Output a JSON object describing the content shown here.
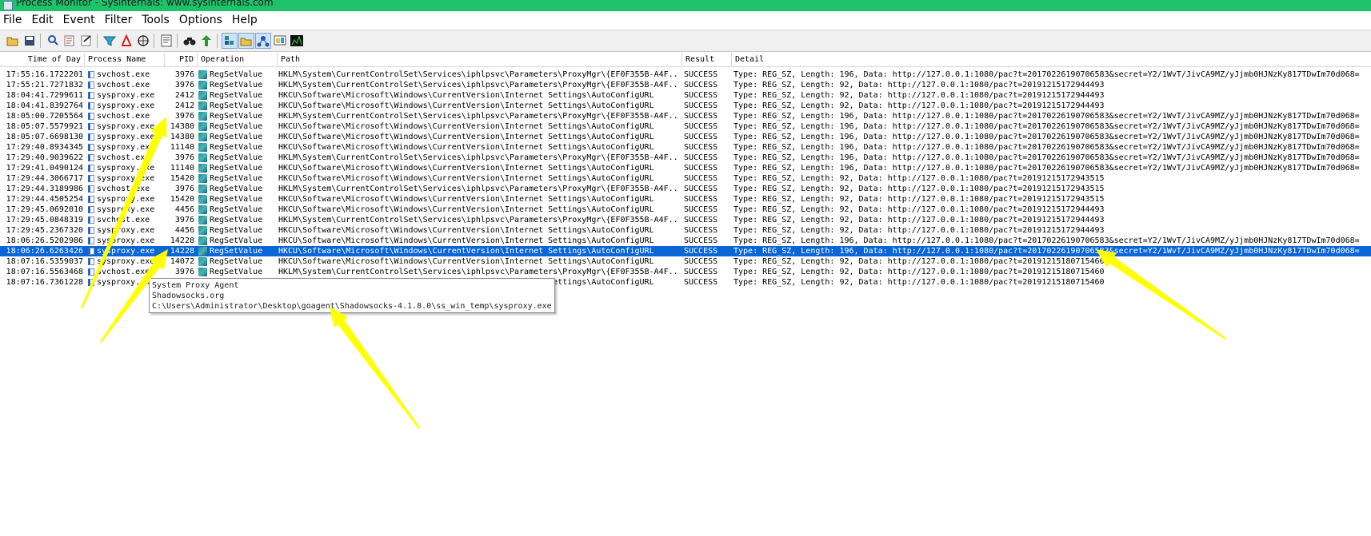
{
  "window": {
    "title": "Process Monitor - Sysinternals: www.sysinternals.com"
  },
  "menu": [
    "File",
    "Edit",
    "Event",
    "Filter",
    "Tools",
    "Options",
    "Help"
  ],
  "toolbar": {
    "buttons": [
      {
        "icon": "open-folder-icon",
        "active": false
      },
      {
        "icon": "save-icon",
        "active": false
      },
      {
        "icon": "magnifier-icon",
        "active": false
      },
      {
        "icon": "autoscroll-icon",
        "active": false
      },
      {
        "icon": "clear-icon",
        "active": false
      },
      {
        "icon": "filter-icon",
        "active": false
      },
      {
        "icon": "highlight-icon",
        "active": false
      },
      {
        "icon": "target-icon",
        "active": false
      },
      {
        "icon": "process-tree-icon",
        "active": false
      },
      {
        "icon": "find-icon",
        "active": false
      },
      {
        "icon": "jump-icon",
        "active": false
      },
      {
        "icon": "registry-activity-icon",
        "active": true
      },
      {
        "icon": "filesystem-activity-icon",
        "active": true
      },
      {
        "icon": "network-activity-icon",
        "active": true
      },
      {
        "icon": "process-activity-icon",
        "active": false
      },
      {
        "icon": "profiling-activity-icon",
        "active": false
      }
    ],
    "colors": {
      "active_bg": "#cfe3f7"
    }
  },
  "columns": [
    "Time of Day",
    "Process Name",
    "PID",
    "Operation",
    "Path",
    "Result",
    "Detail"
  ],
  "selection_color": "#0a66d6",
  "rows": [
    {
      "time": "17:55:16.1722201",
      "process": "svchost.exe",
      "pid": "3976",
      "operation": "RegSetValue",
      "path": "HKLM\\System\\CurrentControlSet\\Services\\iphlpsvc\\Parameters\\ProxyMgr\\{EF0F355B-A4F...",
      "result": "SUCCESS",
      "detail": "Type: REG_SZ, Length: 196, Data: http://127.0.0.1:1080/pac?t=20170226190706583&secret=Y2/1WvT/JivCA9MZ/yJjmb0HJNzKy817TDwIm70d068="
    },
    {
      "time": "17:55:21.7271832",
      "process": "svchost.exe",
      "pid": "3976",
      "operation": "RegSetValue",
      "path": "HKLM\\System\\CurrentControlSet\\Services\\iphlpsvc\\Parameters\\ProxyMgr\\{EF0F355B-A4F...",
      "result": "SUCCESS",
      "detail": "Type: REG_SZ, Length: 92, Data: http://127.0.0.1:1080/pac?t=20191215172944493"
    },
    {
      "time": "18:04:41.7299611",
      "process": "sysproxy.exe",
      "pid": "2412",
      "operation": "RegSetValue",
      "path": "HKCU\\Software\\Microsoft\\Windows\\CurrentVersion\\Internet Settings\\AutoConfigURL",
      "result": "SUCCESS",
      "detail": "Type: REG_SZ, Length: 92, Data: http://127.0.0.1:1080/pac?t=20191215172944493"
    },
    {
      "time": "18:04:41.8392764",
      "process": "sysproxy.exe",
      "pid": "2412",
      "operation": "RegSetValue",
      "path": "HKCU\\Software\\Microsoft\\Windows\\CurrentVersion\\Internet Settings\\AutoConfigURL",
      "result": "SUCCESS",
      "detail": "Type: REG_SZ, Length: 92, Data: http://127.0.0.1:1080/pac?t=20191215172944493"
    },
    {
      "time": "18:05:00.7205564",
      "process": "svchost.exe",
      "pid": "3976",
      "operation": "RegSetValue",
      "path": "HKLM\\System\\CurrentControlSet\\Services\\iphlpsvc\\Parameters\\ProxyMgr\\{EF0F355B-A4F...",
      "result": "SUCCESS",
      "detail": "Type: REG_SZ, Length: 196, Data: http://127.0.0.1:1080/pac?t=20170226190706583&secret=Y2/1WvT/JivCA9MZ/yJjmb0HJNzKy817TDwIm70d068="
    },
    {
      "time": "18:05:07.5579921",
      "process": "sysproxy.exe",
      "pid": "14380",
      "operation": "RegSetValue",
      "path": "HKCU\\Software\\Microsoft\\Windows\\CurrentVersion\\Internet Settings\\AutoConfigURL",
      "result": "SUCCESS",
      "detail": "Type: REG_SZ, Length: 196, Data: http://127.0.0.1:1080/pac?t=20170226190706583&secret=Y2/1WvT/JivCA9MZ/yJjmb0HJNzKy817TDwIm70d068="
    },
    {
      "time": "18:05:07.6698130",
      "process": "sysproxy.exe",
      "pid": "14380",
      "operation": "RegSetValue",
      "path": "HKCU\\Software\\Microsoft\\Windows\\CurrentVersion\\Internet Settings\\AutoConfigURL",
      "result": "SUCCESS",
      "detail": "Type: REG_SZ, Length: 196, Data: http://127.0.0.1:1080/pac?t=20170226190706583&secret=Y2/1WvT/JivCA9MZ/yJjmb0HJNzKy817TDwIm70d068="
    },
    {
      "time": "17:29:40.8934345",
      "process": "sysproxy.exe",
      "pid": "11140",
      "operation": "RegSetValue",
      "path": "HKCU\\Software\\Microsoft\\Windows\\CurrentVersion\\Internet Settings\\AutoConfigURL",
      "result": "SUCCESS",
      "detail": "Type: REG_SZ, Length: 196, Data: http://127.0.0.1:1080/pac?t=20170226190706583&secret=Y2/1WvT/JivCA9MZ/yJjmb0HJNzKy817TDwIm70d068="
    },
    {
      "time": "17:29:40.9039622",
      "process": "svchost.exe",
      "pid": "3976",
      "operation": "RegSetValue",
      "path": "HKLM\\System\\CurrentControlSet\\Services\\iphlpsvc\\Parameters\\ProxyMgr\\{EF0F355B-A4F...",
      "result": "SUCCESS",
      "detail": "Type: REG_SZ, Length: 196, Data: http://127.0.0.1:1080/pac?t=20170226190706583&secret=Y2/1WvT/JivCA9MZ/yJjmb0HJNzKy817TDwIm70d068="
    },
    {
      "time": "17:29:41.0490124",
      "process": "sysproxy.exe",
      "pid": "11140",
      "operation": "RegSetValue",
      "path": "HKCU\\Software\\Microsoft\\Windows\\CurrentVersion\\Internet Settings\\AutoConfigURL",
      "result": "SUCCESS",
      "detail": "Type: REG_SZ, Length: 196, Data: http://127.0.0.1:1080/pac?t=20170226190706583&secret=Y2/1WvT/JivCA9MZ/yJjmb0HJNzKy817TDwIm70d068="
    },
    {
      "time": "17:29:44.3066717",
      "process": "sysproxy.exe",
      "pid": "15420",
      "operation": "RegSetValue",
      "path": "HKCU\\Software\\Microsoft\\Windows\\CurrentVersion\\Internet Settings\\AutoConfigURL",
      "result": "SUCCESS",
      "detail": "Type: REG_SZ, Length: 92, Data: http://127.0.0.1:1080/pac?t=20191215172943515"
    },
    {
      "time": "17:29:44.3189986",
      "process": "svchost.exe",
      "pid": "3976",
      "operation": "RegSetValue",
      "path": "HKLM\\System\\CurrentControlSet\\Services\\iphlpsvc\\Parameters\\ProxyMgr\\{EF0F355B-A4F...",
      "result": "SUCCESS",
      "detail": "Type: REG_SZ, Length: 92, Data: http://127.0.0.1:1080/pac?t=20191215172943515"
    },
    {
      "time": "17:29:44.4505254",
      "process": "sysproxy.exe",
      "pid": "15420",
      "operation": "RegSetValue",
      "path": "HKCU\\Software\\Microsoft\\Windows\\CurrentVersion\\Internet Settings\\AutoConfigURL",
      "result": "SUCCESS",
      "detail": "Type: REG_SZ, Length: 92, Data: http://127.0.0.1:1080/pac?t=20191215172943515"
    },
    {
      "time": "17:29:45.0692010",
      "process": "sysproxy.exe",
      "pid": "4456",
      "operation": "RegSetValue",
      "path": "HKCU\\Software\\Microsoft\\Windows\\CurrentVersion\\Internet Settings\\AutoConfigURL",
      "result": "SUCCESS",
      "detail": "Type: REG_SZ, Length: 92, Data: http://127.0.0.1:1080/pac?t=20191215172944493"
    },
    {
      "time": "17:29:45.0848319",
      "process": "svchost.exe",
      "pid": "3976",
      "operation": "RegSetValue",
      "path": "HKLM\\System\\CurrentControlSet\\Services\\iphlpsvc\\Parameters\\ProxyMgr\\{EF0F355B-A4F...",
      "result": "SUCCESS",
      "detail": "Type: REG_SZ, Length: 92, Data: http://127.0.0.1:1080/pac?t=20191215172944493"
    },
    {
      "time": "17:29:45.2367320",
      "process": "sysproxy.exe",
      "pid": "4456",
      "operation": "RegSetValue",
      "path": "HKCU\\Software\\Microsoft\\Windows\\CurrentVersion\\Internet Settings\\AutoConfigURL",
      "result": "SUCCESS",
      "detail": "Type: REG_SZ, Length: 92, Data: http://127.0.0.1:1080/pac?t=20191215172944493"
    },
    {
      "time": "18:06:26.5202986",
      "process": "sysproxy.exe",
      "pid": "14228",
      "operation": "RegSetValue",
      "path": "HKCU\\Software\\Microsoft\\Windows\\CurrentVersion\\Internet Settings\\AutoConfigURL",
      "result": "SUCCESS",
      "detail": "Type: REG_SZ, Length: 196, Data: http://127.0.0.1:1080/pac?t=20170226190706583&secret=Y2/1WvT/JivCA9MZ/yJjmb0HJNzKy817TDwIm70d068="
    },
    {
      "time": "18:06:26.6263426",
      "process": "sysproxy.exe",
      "pid": "14228",
      "operation": "RegSetValue",
      "path": "HKCU\\Software\\Microsoft\\Windows\\CurrentVersion\\Internet Settings\\AutoConfigURL",
      "result": "SUCCESS",
      "detail": "Type: REG_SZ, Length: 196, Data: http://127.0.0.1:1080/pac?t=20170226190706583&secret=Y2/1WvT/JivCA9MZ/yJjmb0HJNzKy817TDwIm70d068=",
      "selected": true
    },
    {
      "time": "18:07:16.5359037",
      "process": "sysproxy.exe",
      "pid": "14072",
      "operation": "RegSetValue",
      "path": "HKCU\\Software\\Microsoft\\Windows\\CurrentVersion\\Internet Settings\\AutoConfigURL",
      "result": "SUCCESS",
      "detail": "Type: REG_SZ, Length: 92, Data: http://127.0.0.1:1080/pac?t=20191215180715460"
    },
    {
      "time": "18:07:16.5563468",
      "process": "svchost.exe",
      "pid": "3976",
      "operation": "RegSetValue",
      "path": "HKLM\\System\\CurrentControlSet\\Services\\iphlpsvc\\Parameters\\ProxyMgr\\{EF0F355B-A4F...",
      "result": "SUCCESS",
      "detail": "Type: REG_SZ, Length: 92, Data: http://127.0.0.1:1080/pac?t=20191215180715460"
    },
    {
      "time": "18:07:16.7361228",
      "process": "sysproxy.exe",
      "pid": "14072",
      "operation": "RegSetValue",
      "path": "HKCU\\Software\\Microsoft\\Windows\\CurrentVersion\\Internet Settings\\AutoConfigURL",
      "result": "SUCCESS",
      "detail": "Type: REG_SZ, Length: 92, Data: http://127.0.0.1:1080/pac?t=20191215180715460"
    }
  ],
  "tooltip": {
    "line1": "System Proxy Agent",
    "line2": "Shadowsocks.org",
    "line3": "C:\\Users\\Administrator\\Desktop\\goagent\\Shadowsocks-4.1.8.0\\ss_win_temp\\sysproxy.exe"
  },
  "annotation_color": "#ffff00"
}
